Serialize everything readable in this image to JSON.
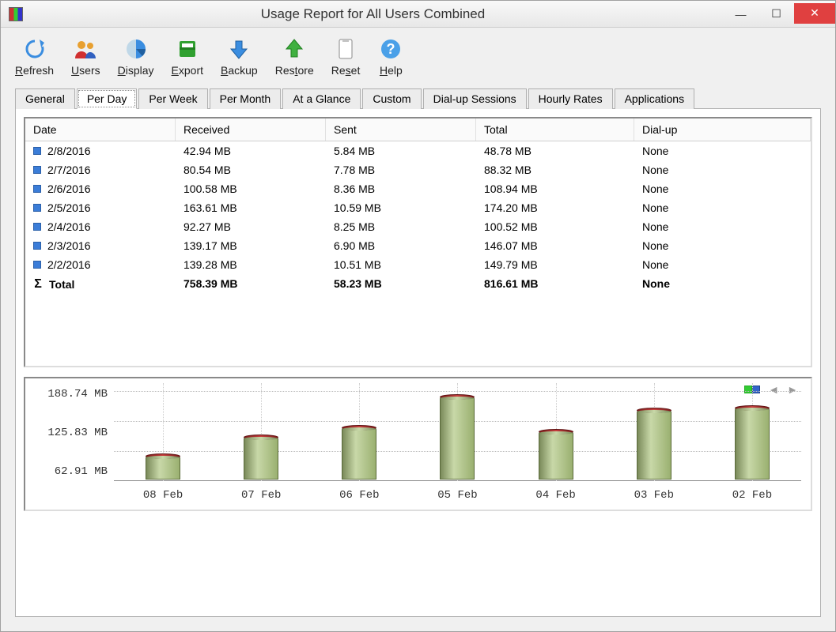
{
  "window": {
    "title": "Usage Report for All Users Combined"
  },
  "toolbar": [
    {
      "key": "refresh",
      "label": "Refresh",
      "ul": "R"
    },
    {
      "key": "users",
      "label": "Users",
      "ul": "U"
    },
    {
      "key": "display",
      "label": "Display",
      "ul": "D"
    },
    {
      "key": "export",
      "label": "Export",
      "ul": "E"
    },
    {
      "key": "backup",
      "label": "Backup",
      "ul": "B"
    },
    {
      "key": "restore",
      "label": "Restore",
      "ul": "t"
    },
    {
      "key": "reset",
      "label": "Reset",
      "ul": "s"
    },
    {
      "key": "help",
      "label": "Help",
      "ul": "H"
    }
  ],
  "tabs": [
    "General",
    "Per Day",
    "Per Week",
    "Per Month",
    "At a Glance",
    "Custom",
    "Dial-up Sessions",
    "Hourly Rates",
    "Applications"
  ],
  "active_tab": "Per Day",
  "table": {
    "columns": [
      "Date",
      "Received",
      "Sent",
      "Total",
      "Dial-up"
    ],
    "rows": [
      {
        "date": "2/8/2016",
        "received": "42.94 MB",
        "sent": "5.84 MB",
        "total": "48.78 MB",
        "dialup": "None"
      },
      {
        "date": "2/7/2016",
        "received": "80.54 MB",
        "sent": "7.78 MB",
        "total": "88.32 MB",
        "dialup": "None"
      },
      {
        "date": "2/6/2016",
        "received": "100.58 MB",
        "sent": "8.36 MB",
        "total": "108.94 MB",
        "dialup": "None"
      },
      {
        "date": "2/5/2016",
        "received": "163.61 MB",
        "sent": "10.59 MB",
        "total": "174.20 MB",
        "dialup": "None"
      },
      {
        "date": "2/4/2016",
        "received": "92.27 MB",
        "sent": "8.25 MB",
        "total": "100.52 MB",
        "dialup": "None"
      },
      {
        "date": "2/3/2016",
        "received": "139.17 MB",
        "sent": "6.90 MB",
        "total": "146.07 MB",
        "dialup": "None"
      },
      {
        "date": "2/2/2016",
        "received": "139.28 MB",
        "sent": "10.51 MB",
        "total": "149.79 MB",
        "dialup": "None"
      }
    ],
    "total": {
      "label": "Total",
      "received": "758.39 MB",
      "sent": "58.23 MB",
      "total": "816.61 MB",
      "dialup": "None"
    }
  },
  "chart_data": {
    "type": "bar",
    "categories": [
      "08 Feb",
      "07 Feb",
      "06 Feb",
      "05 Feb",
      "04 Feb",
      "03 Feb",
      "02 Feb"
    ],
    "series": [
      {
        "name": "Received",
        "values": [
          42.94,
          80.54,
          100.58,
          163.61,
          92.27,
          139.17,
          139.28
        ]
      },
      {
        "name": "Sent",
        "values": [
          5.84,
          7.78,
          8.36,
          10.59,
          8.25,
          6.9,
          10.51
        ]
      }
    ],
    "stacked_totals": [
      48.78,
      88.32,
      108.94,
      174.2,
      100.52,
      146.07,
      149.79
    ],
    "ylabel": "MB",
    "y_ticks": [
      "188.74 MB",
      "125.83 MB",
      "62.91 MB"
    ],
    "ylim": [
      0,
      188.74
    ]
  }
}
